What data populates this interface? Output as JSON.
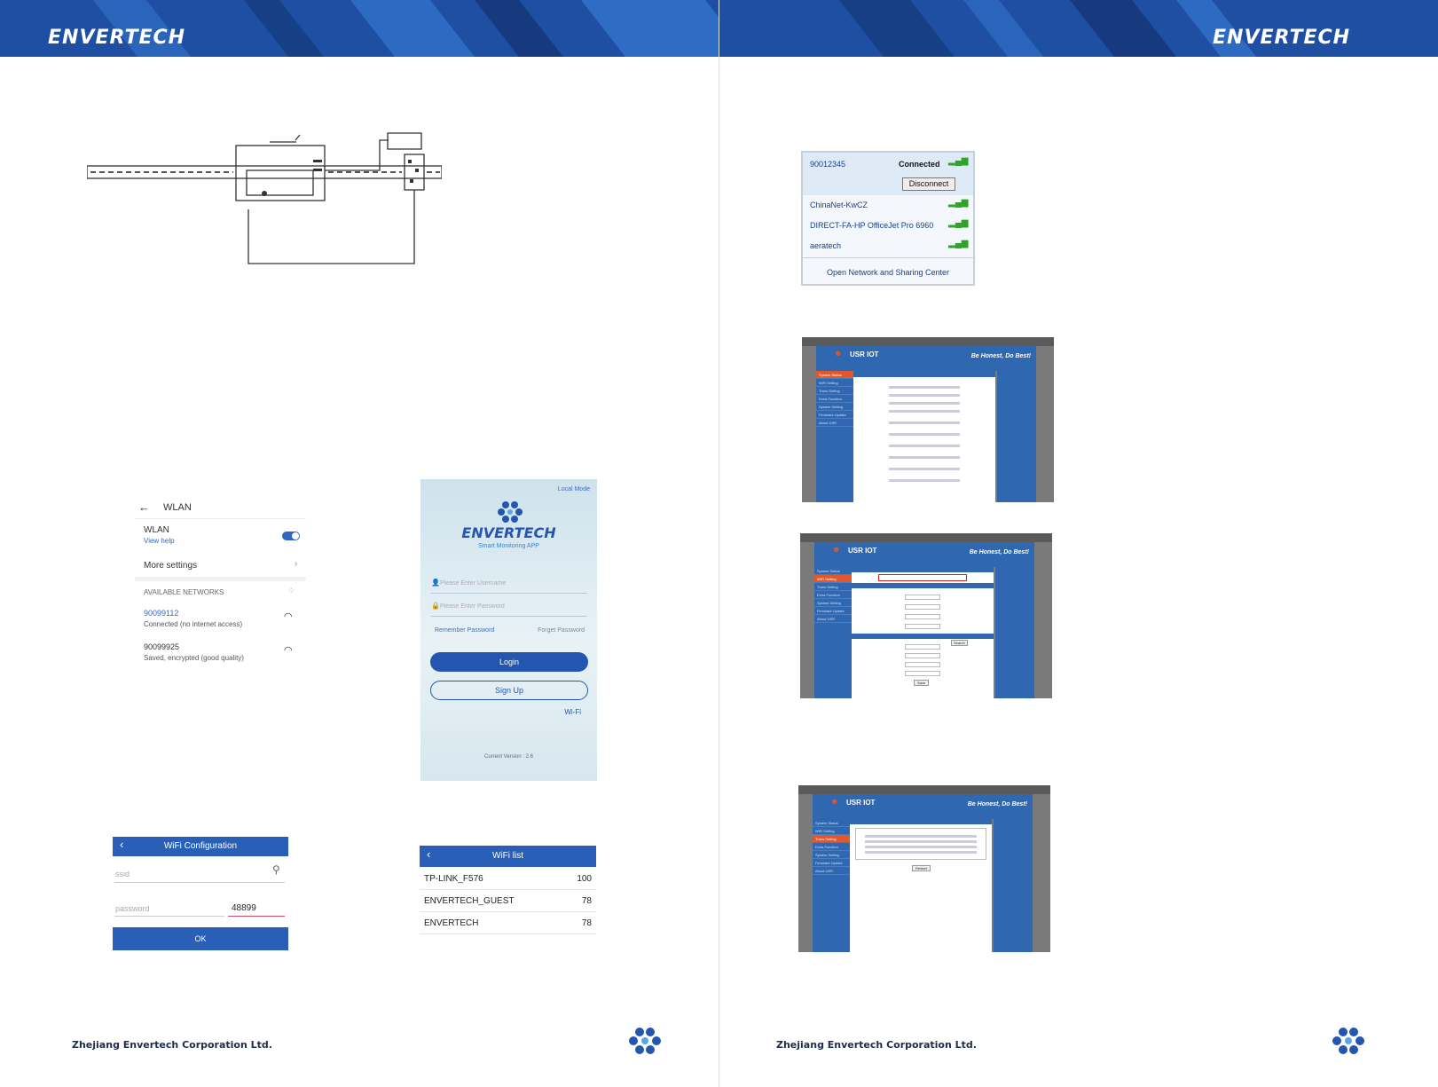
{
  "brand": {
    "logo_left": "ENVERTECH",
    "logo_right": "ENVERTECH",
    "colors": {
      "banner": "#1f4fa3",
      "accent": "#2f5db0"
    }
  },
  "footer": {
    "company_left": "Zhejiang Envertech Corporation Ltd.",
    "company_right": "Zhejiang Envertech Corporation Ltd."
  },
  "wifi_popup": {
    "connected_network": "90012345",
    "connected_status": "Connected",
    "disconnect_label": "Disconnect",
    "networks": [
      {
        "name": "ChinaNet-KwCZ"
      },
      {
        "name": "DIRECT-FA-HP OfficeJet Pro 6960"
      },
      {
        "name": "aeratech"
      }
    ],
    "open_center_label": "Open Network and Sharing Center"
  },
  "usr_status": {
    "title": "USR IOT",
    "slogan": "Be Honest, Do Best!",
    "nav": [
      "System Status",
      "WiFi Setting",
      "Trans Setting",
      "Extra Function",
      "System Setting",
      "Firmware Update",
      "About USR"
    ],
    "active_nav": 0
  },
  "usr_wifi": {
    "title": "USR IOT",
    "slogan": "Be Honest, Do Best!",
    "nav": [
      "System Status",
      "WiFi Setting",
      "Trans Setting",
      "Extra Function",
      "System Setting",
      "Firmware Update",
      "About USR"
    ],
    "active_nav": 1,
    "save_label": "Save",
    "search_label": "Search"
  },
  "usr_restart": {
    "title": "USR IOT",
    "slogan": "Be Honest, Do Best!",
    "nav": [
      "System Status",
      "WiFi Setting",
      "Trans Setting",
      "Extra Function",
      "System Setting",
      "Firmware Update",
      "About USR"
    ],
    "active_nav": 2,
    "restart_label": "Restart"
  },
  "wlan_screen": {
    "title": "WLAN",
    "wlan_label": "WLAN",
    "view_help": "View help",
    "more_settings": "More settings",
    "available_networks": "AVAILABLE NETWORKS",
    "networks": [
      {
        "name": "90099112",
        "status": "Connected (no internet access)"
      },
      {
        "name": "90099925",
        "status": "Saved, encrypted (good quality)"
      }
    ]
  },
  "app_screen": {
    "local_mode": "Local Mode",
    "logo": "ENVERTECH",
    "subtitle": "Smart Monitoring APP",
    "username_placeholder": "Please Enter Username",
    "password_placeholder": "Please Enter Password",
    "remember_password": "Remember Password",
    "forget_password": "Forget Password",
    "login_label": "Login",
    "signup_label": "Sign Up",
    "wifi_link": "Wi-Fi",
    "version": "Current Version : 2.6"
  },
  "wifi_config": {
    "title": "WiFi Configuration",
    "ssid_placeholder": "ssid",
    "password_label": "password",
    "password_value": "48899",
    "ok_label": "OK"
  },
  "wifi_list": {
    "title": "WiFi list",
    "items": [
      {
        "name": "TP-LINK_F576",
        "signal": "100"
      },
      {
        "name": "ENVERTECH_GUEST",
        "signal": "78"
      },
      {
        "name": "ENVERTECH",
        "signal": "78"
      }
    ]
  }
}
